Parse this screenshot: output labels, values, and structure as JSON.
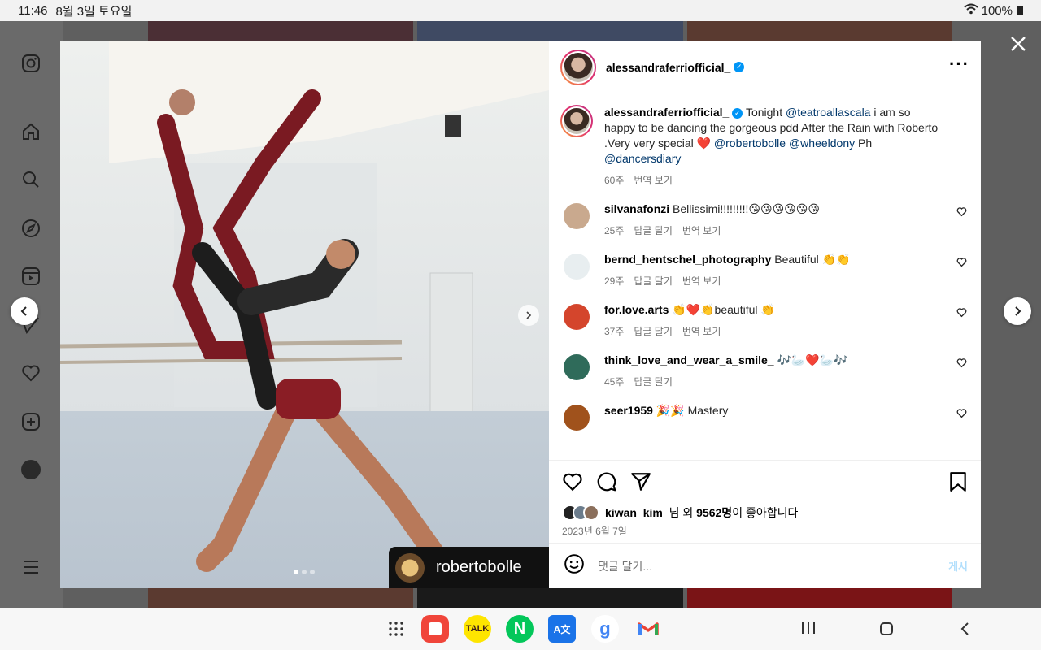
{
  "status_bar": {
    "time": "11:46",
    "date": "8월 3일 토요일",
    "battery": "100%"
  },
  "post": {
    "username": "alessandraferriofficial_",
    "photo_tag": "robertobolle",
    "caption": {
      "user": "alessandraferriofficial_",
      "segments": [
        {
          "t": "Tonight "
        },
        {
          "t": "@teatroallascala",
          "m": true
        },
        {
          "t": " i am so happy to be dancing the gorgeous pdd After the Rain with Roberto .Very very special ❤️ "
        },
        {
          "t": "@robertobolle",
          "m": true
        },
        {
          "t": " "
        },
        {
          "t": "@wheeldony",
          "m": true
        },
        {
          "t": " Ph "
        },
        {
          "t": "@dancersdiary",
          "m": true
        }
      ],
      "age": "60주",
      "translate": "번역 보기"
    },
    "comments": [
      {
        "user": "silvanafonzi",
        "text": "Bellissimi!!!!!!!!!😘😘😘😘😘😘",
        "age": "25주",
        "reply": "답글 달기",
        "translate": "번역 보기",
        "color": "#c9a98e"
      },
      {
        "user": "bernd_hentschel_photography",
        "text": "Beautiful 👏👏",
        "age": "29주",
        "reply": "답글 달기",
        "translate": "번역 보기",
        "color": "#e8eef0"
      },
      {
        "user": "for.love.arts",
        "text": "👏❤️👏beautiful 👏",
        "age": "37주",
        "reply": "답글 달기",
        "translate": "번역 보기",
        "color": "#d4452c"
      },
      {
        "user": "think_love_and_wear_a_smile_",
        "text": "🎶🦢❤️🦢🎶",
        "age": "45주",
        "reply": "답글 달기",
        "translate": "",
        "color": "#2f6b5a"
      },
      {
        "user": "seer1959",
        "text": "🎉🎉 Mastery",
        "age": "",
        "reply": "",
        "translate": "",
        "color": "#a0521c"
      }
    ],
    "likes": {
      "user": "kiwan_kim_",
      "text1": "님 외 ",
      "count": "9562명",
      "text2": "이 좋아합니다"
    },
    "date": "2023년 6월 7일",
    "comment_placeholder": "댓글 달기...",
    "post_button": "게시"
  },
  "colors": {
    "accent": "#0095f6",
    "mention": "#00376b",
    "like_red": "#ed4956"
  }
}
